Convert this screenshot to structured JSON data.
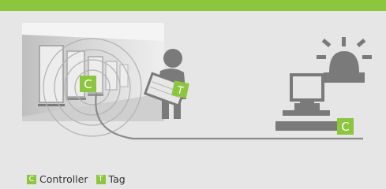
{
  "colors": {
    "accent_green": "#8cc63f",
    "background": "#e6e6e6",
    "signal_ring": "#b4b4b4",
    "figure_gray": "#7a7a7a",
    "cable_gray": "#8a8a8a"
  },
  "badges": {
    "controller_letter": "C",
    "tag_letter": "T"
  },
  "legend": {
    "controller_letter": "C",
    "controller_label": "Controller",
    "tag_letter": "T",
    "tag_label": "Tag"
  },
  "icons": [
    "room-photo",
    "signal-waves-icon",
    "person-carrying-box-icon",
    "computer-workstation-icon",
    "alarm-light-icon"
  ]
}
